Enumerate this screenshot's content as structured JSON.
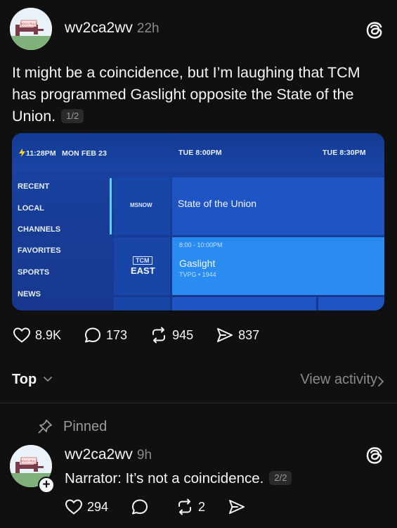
{
  "post": {
    "username": "wv2ca2wv",
    "time": "22h",
    "text": "It might be a coincidence, but I’m laughing that TCM has programmed Gaslight opposite the State of the Union.",
    "page_badge": "1/2",
    "avatar_sign": "DOGS RULE",
    "image": {
      "clock": "11:28PM",
      "date": "MON FEB 23",
      "slot1": "TUE 8:00PM",
      "slot2": "TUE 8:30PM",
      "sidebar": [
        "RECENT",
        "LOCAL",
        "CHANNELS",
        "FAVORITES",
        "SPORTS",
        "NEWS"
      ],
      "channel1_logo": "MSNOW",
      "program1_title": "State of the Union",
      "channel2_logo": "TCM",
      "channel2_sub": "EAST",
      "program2_time": "8:00 - 10:00PM",
      "program2_title": "Gaslight",
      "program2_meta": "TVPG • 1944"
    },
    "likes": "8.9K",
    "comments": "173",
    "reposts": "945",
    "shares": "837"
  },
  "sort": {
    "label": "Top",
    "view_activity": "View activity"
  },
  "reply": {
    "pinned_label": "Pinned",
    "username": "wv2ca2wv",
    "time": "9h",
    "text": "Narrator: It’s not a coincidence.",
    "page_badge": "2/2",
    "avatar_sign": "DOGS RULE",
    "likes": "294",
    "reposts": "2"
  },
  "icons": {
    "threads": "threads-logo-icon",
    "like": "heart-icon",
    "comment": "comment-icon",
    "repost": "repost-icon",
    "share": "share-icon",
    "pin": "pin-icon",
    "chevron": "chevron-icon",
    "plus": "plus-icon"
  },
  "colors": {
    "background": "#101010",
    "text": "#f3f5f7",
    "muted": "#8a8a8a",
    "tv_blue": "#1c46a8",
    "tv_highlight": "#2a8cf0"
  }
}
